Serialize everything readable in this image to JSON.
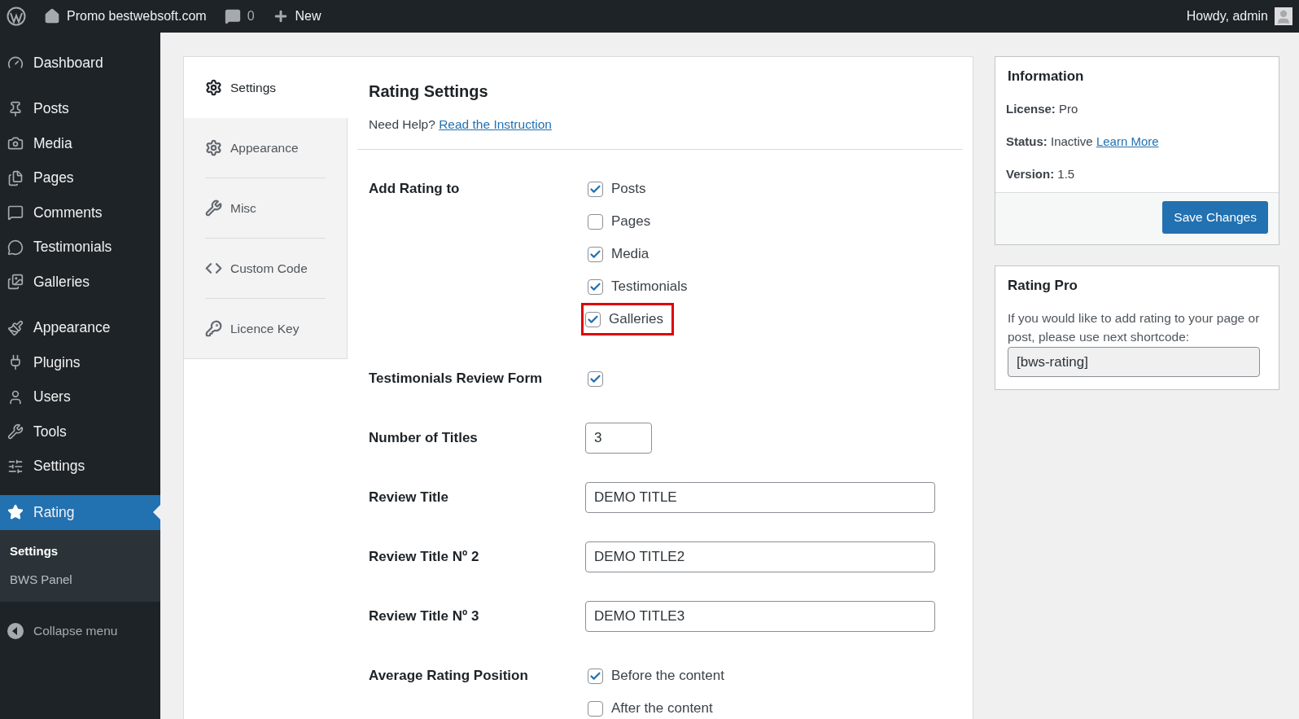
{
  "top_bar": {
    "site": "Promo bestwebsoft.com",
    "comments": "0",
    "new": "New",
    "greeting": "Howdy, admin"
  },
  "sidebar": {
    "groups": [
      [
        {
          "label": "Dashboard",
          "selected": false
        }
      ],
      [
        {
          "label": "Posts",
          "selected": false
        },
        {
          "label": "Media",
          "selected": false
        },
        {
          "label": "Pages",
          "selected": false
        },
        {
          "label": "Comments",
          "selected": false
        },
        {
          "label": "Testimonials",
          "selected": false
        },
        {
          "label": "Galleries",
          "selected": false
        }
      ],
      [
        {
          "label": "Appearance",
          "selected": false
        },
        {
          "label": "Plugins",
          "selected": false
        },
        {
          "label": "Users",
          "selected": false
        },
        {
          "label": "Tools",
          "selected": false
        },
        {
          "label": "Settings",
          "selected": false
        }
      ],
      [
        {
          "label": "Rating",
          "selected": true,
          "submenu": [
            {
              "label": "Settings",
              "selected": true
            },
            {
              "label": "BWS Panel",
              "selected": false
            }
          ]
        }
      ]
    ],
    "collapse": "Collapse menu"
  },
  "tabs": [
    {
      "label": "Settings",
      "selected": true
    },
    {
      "label": "Appearance",
      "selected": false
    },
    {
      "label": "Misc",
      "selected": false
    },
    {
      "label": "Custom Code",
      "selected": false
    },
    {
      "label": "Licence Key",
      "selected": false
    }
  ],
  "settings": {
    "title": "Rating Settings",
    "help": "Need Help?",
    "help_link": "Read the Instruction",
    "rows": [
      {
        "kind": "checkboxes",
        "label": "Add Rating to",
        "options": [
          {
            "label": "Posts",
            "checked": true,
            "highlighted": false
          },
          {
            "label": "Pages",
            "checked": false,
            "highlighted": false
          },
          {
            "label": "Media",
            "checked": true,
            "highlighted": false
          },
          {
            "label": "Testimonials",
            "checked": true,
            "highlighted": false
          },
          {
            "label": "Galleries",
            "checked": true,
            "highlighted": true
          }
        ]
      },
      {
        "kind": "checkbox",
        "label": "Testimonials Review Form",
        "checked": true
      },
      {
        "kind": "number",
        "label": "Number of Titles",
        "value": "3"
      },
      {
        "kind": "text",
        "label": "Review Title",
        "value": "DEMO TITLE"
      },
      {
        "kind": "text",
        "label": "Review Title Nº 2",
        "value": "DEMO TITLE2"
      },
      {
        "kind": "text",
        "label": "Review Title Nº 3",
        "value": "DEMO TITLE3"
      },
      {
        "kind": "checkboxes",
        "label": "Average Rating Position",
        "options": [
          {
            "label": "Before the content",
            "checked": true,
            "highlighted": false
          },
          {
            "label": "After the content",
            "checked": false,
            "highlighted": false
          }
        ]
      }
    ]
  },
  "information": {
    "title": "Information",
    "lines": [
      {
        "key": "License:",
        "value": "Pro"
      },
      {
        "key": "Status:",
        "value": "Inactive",
        "link": "Learn More"
      },
      {
        "key": "Version:",
        "value": "1.5"
      }
    ],
    "button": "Save Changes"
  },
  "rating_pro": {
    "title": "Rating Pro",
    "text": "If you would like to add rating to your page or post, please use next shortcode:",
    "shortcode": "[bws-rating]"
  }
}
